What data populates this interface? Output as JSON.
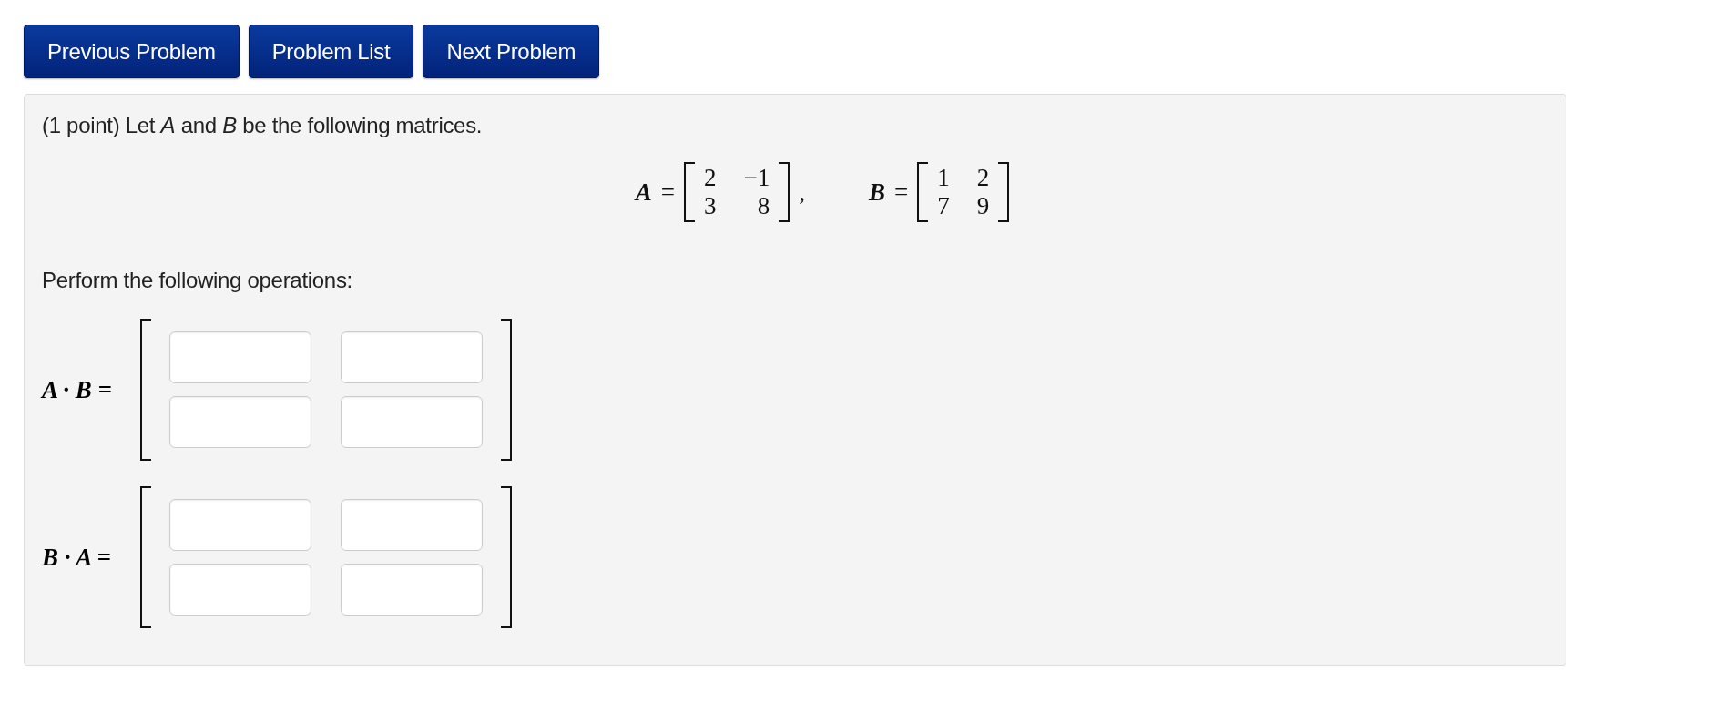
{
  "nav_buttons": [
    "Previous Problem",
    "Problem List",
    "Next Problem"
  ],
  "problem": {
    "intro": "(1 point) Let *A* and *B* be the following matrices.",
    "given": [
      {
        "name": "A",
        "equals": "=",
        "rows": [
          [
            "2",
            "−1"
          ],
          [
            "3",
            "8"
          ]
        ],
        "separator": ","
      },
      {
        "name": "B",
        "equals": "=",
        "rows": [
          [
            "1",
            "2"
          ],
          [
            "7",
            "9"
          ]
        ]
      }
    ],
    "instruction": "Perform the following operations:",
    "operations": [
      {
        "label": "A · B =",
        "rows": [
          [
            "",
            ""
          ],
          [
            "",
            ""
          ]
        ]
      },
      {
        "label": "B · A =",
        "rows": [
          [
            "",
            ""
          ],
          [
            "",
            ""
          ]
        ]
      }
    ]
  }
}
